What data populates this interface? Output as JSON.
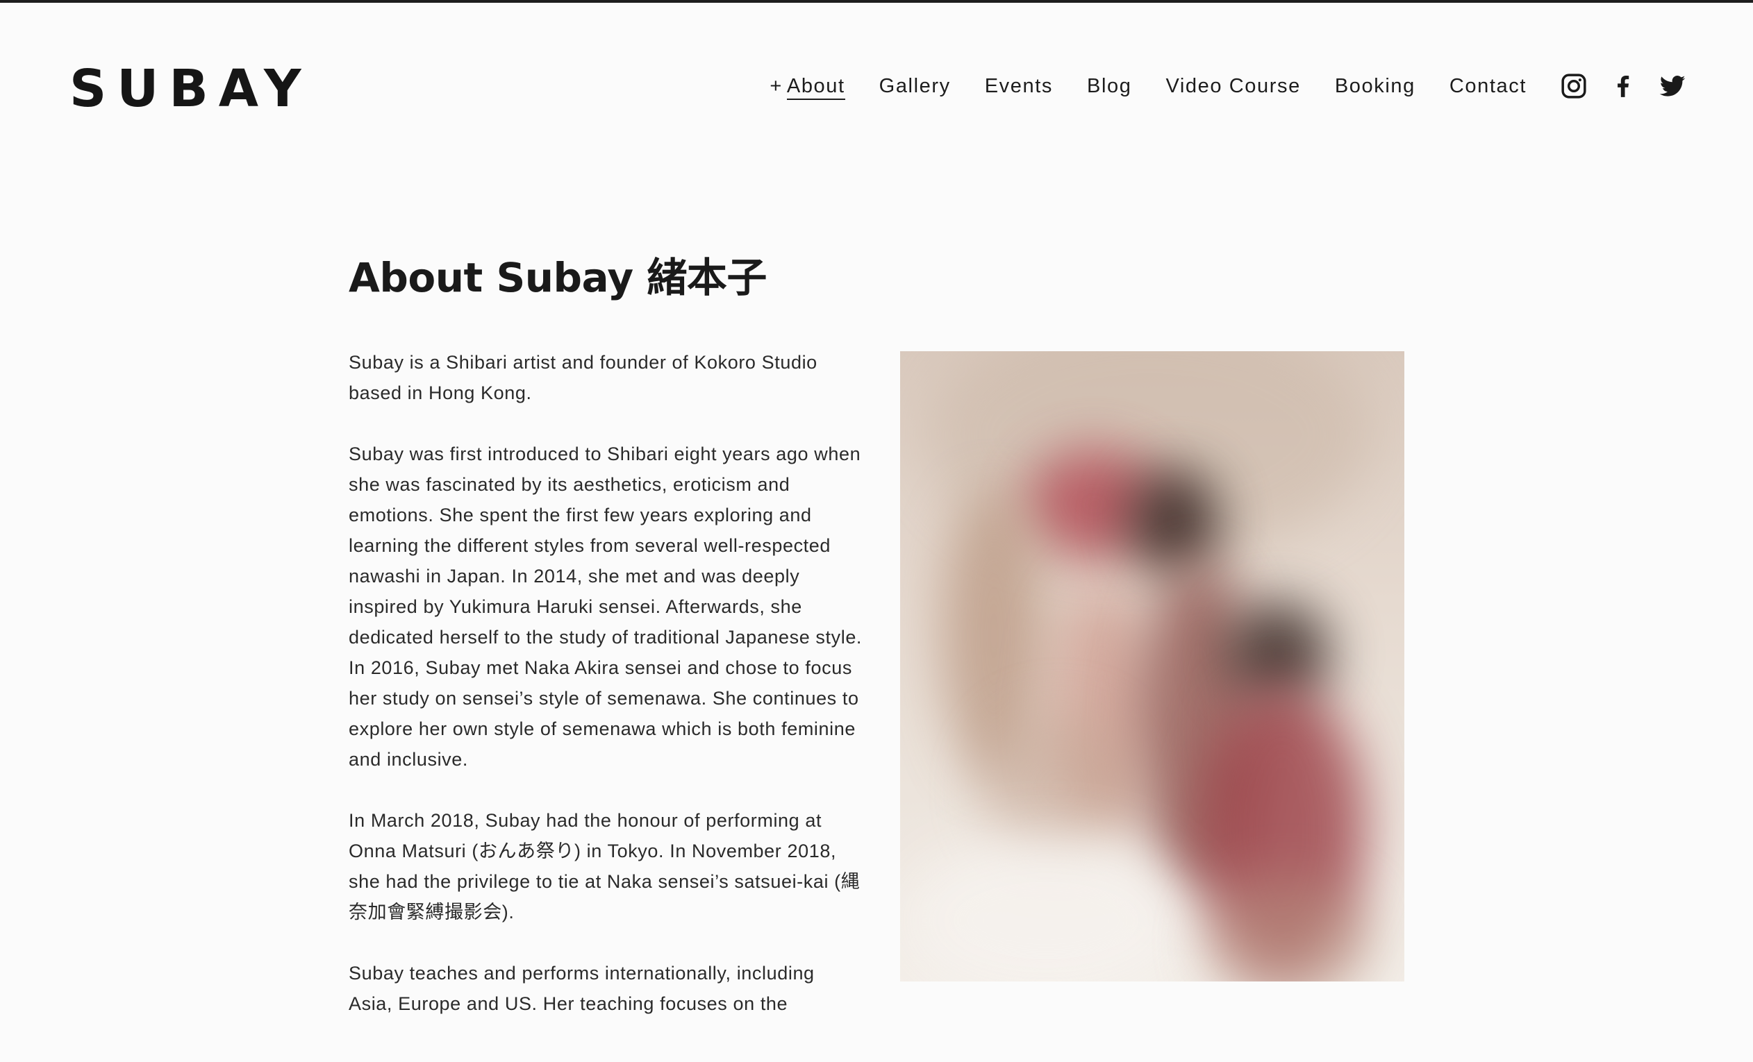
{
  "site": {
    "logo": "SUBAY"
  },
  "nav": {
    "items": [
      {
        "label": "About",
        "prefix": "+",
        "active": true
      },
      {
        "label": "Gallery"
      },
      {
        "label": "Events"
      },
      {
        "label": "Blog"
      },
      {
        "label": "Video Course"
      },
      {
        "label": "Booking"
      },
      {
        "label": "Contact"
      }
    ],
    "social": [
      "instagram-icon",
      "facebook-icon",
      "twitter-icon"
    ]
  },
  "main": {
    "title": "About Subay 緒本子",
    "paragraphs": [
      "Subay is a Shibari artist and founder of Kokoro Studio based in Hong Kong.",
      "Subay was first introduced to Shibari eight years ago when she was fascinated by its aesthetics, eroticism and emotions.  She spent the first few years exploring and learning the different styles from several well-respected nawashi in Japan.  In 2014, she met and was deeply inspired by Yukimura Haruki sensei.  Afterwards, she dedicated herself to the study of traditional Japanese style.  In 2016, Subay met Naka Akira sensei and chose to focus her study on sensei’s style of semenawa.  She continues to explore her own style of semenawa which is both feminine and inclusive.",
      "In March 2018, Subay had the honour of performing at Onna Matsuri (おんあ祭り) in Tokyo.  In November 2018, she had the privilege to tie at Naka sensei’s satsuei-kai (縄奈加會緊縛撮影会).",
      "Subay teaches and performs internationally, including Asia, Europe and US.  Her teaching focuses on the"
    ]
  },
  "colors": {
    "background": "#fbfbfb",
    "text": "#1c1c1c",
    "topline": "#1e1e1e"
  }
}
